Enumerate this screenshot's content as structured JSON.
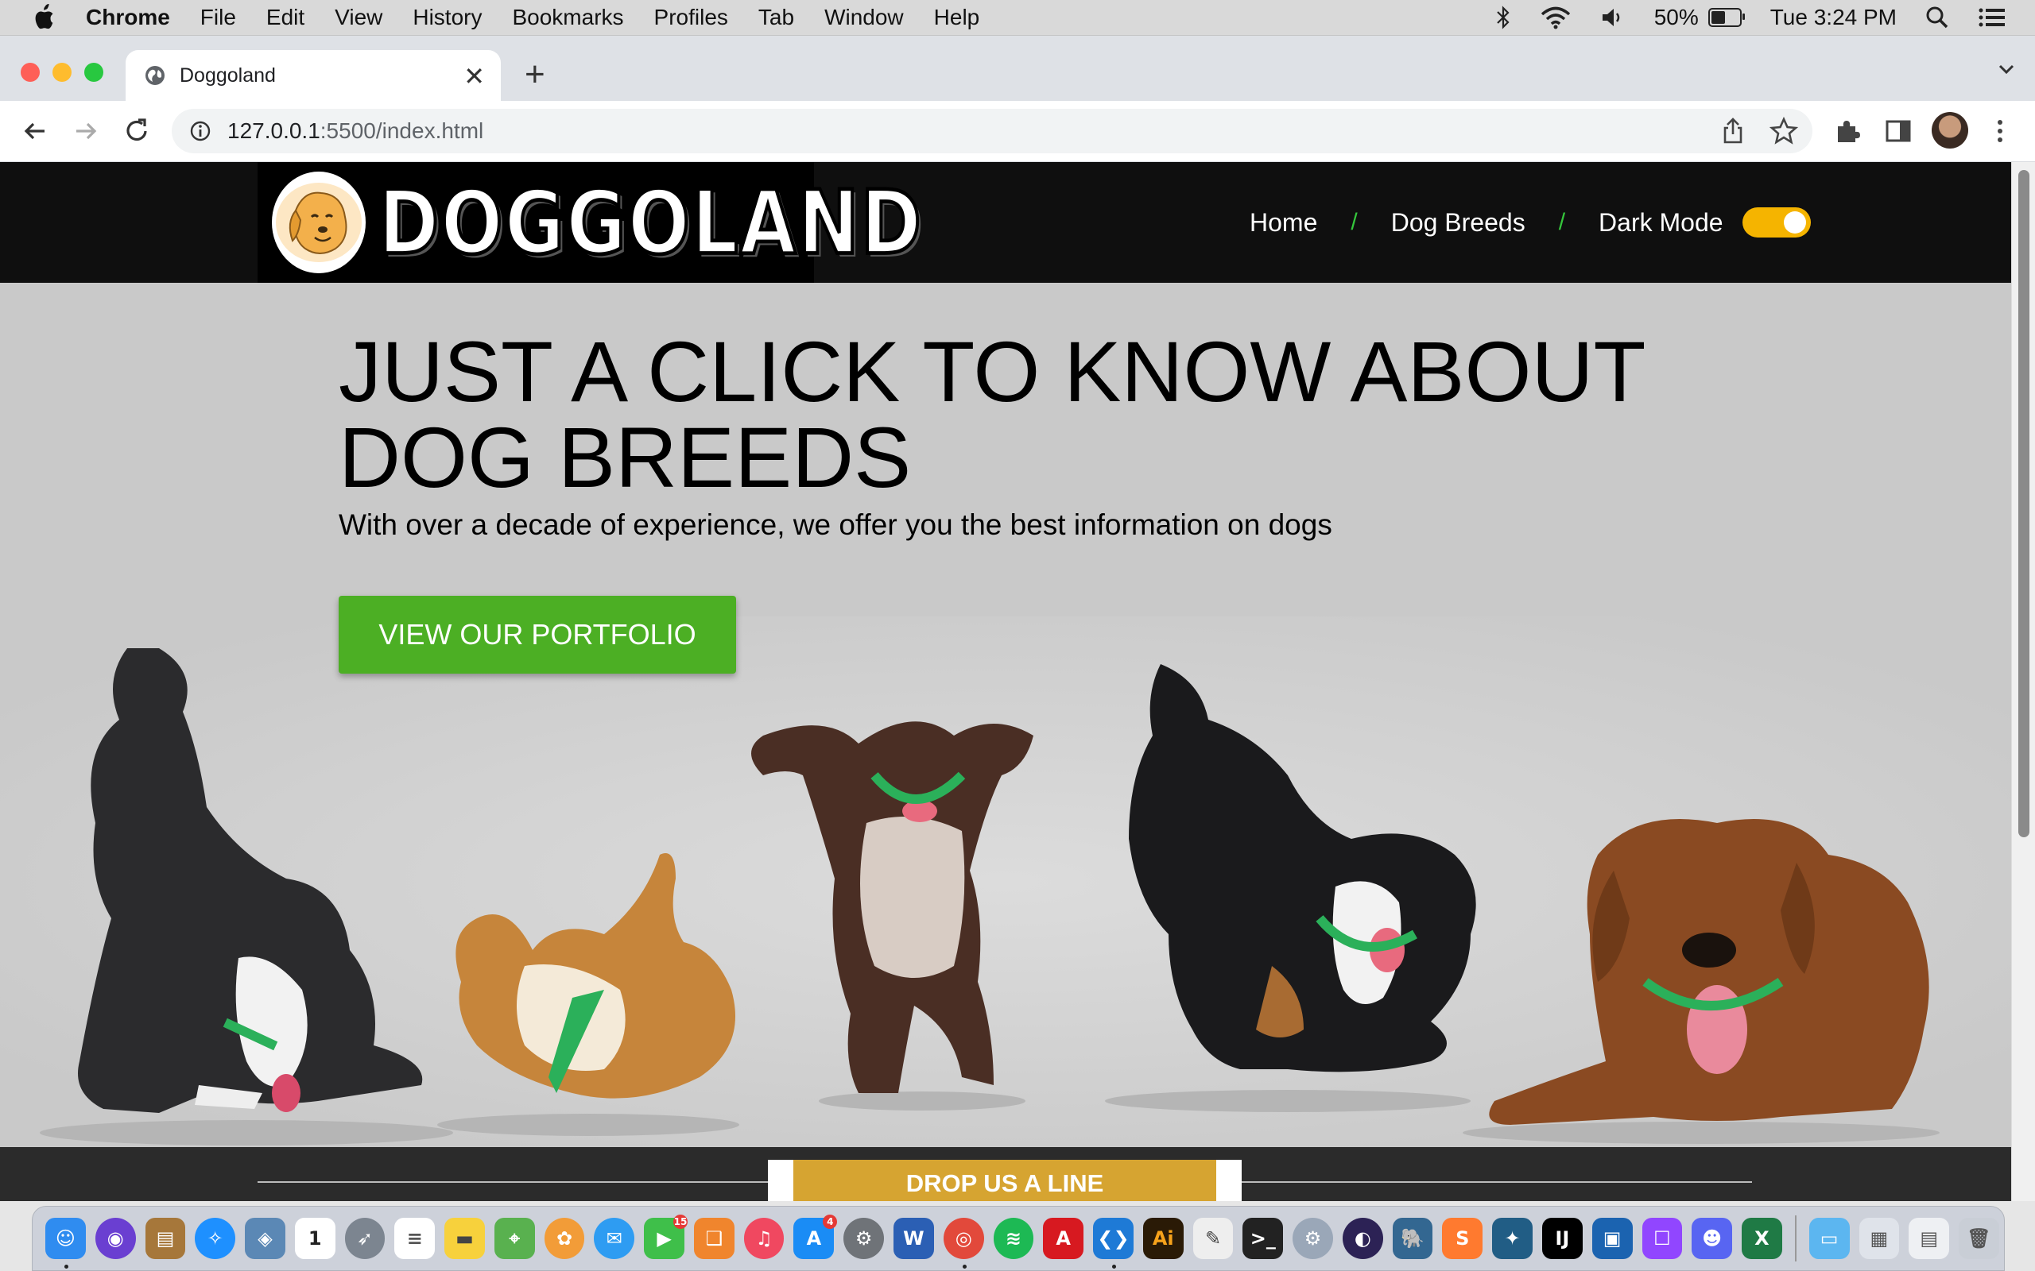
{
  "menubar": {
    "app": "Chrome",
    "items": [
      "File",
      "Edit",
      "View",
      "History",
      "Bookmarks",
      "Profiles",
      "Tab",
      "Window",
      "Help"
    ],
    "battery": "50%",
    "battery_level": 0.5,
    "clock": "Tue 3:24 PM"
  },
  "browser": {
    "tab_title": "Doggoland",
    "url_host": "127.0.0.1",
    "url_rest": ":5500/index.html"
  },
  "site": {
    "nav": {
      "links": [
        "Home",
        "Dog Breeds",
        "Dark Mode"
      ],
      "separator": "/",
      "dark_mode_on": true,
      "toggle_color": "#f5b400",
      "separator_color": "#35c63c"
    },
    "logo_text": "DOGGOLAND",
    "hero": {
      "title": "JUST A CLICK TO KNOW ABOUT DOG BREEDS",
      "subtitle": "With over a decade of experience, we offer you the best information on dogs",
      "cta": "VIEW OUR PORTFOLIO",
      "cta_color": "#4caf24"
    },
    "footer": {
      "drop_button": "DROP US A LINE",
      "drop_color": "#d6a431"
    }
  },
  "dock": {
    "apps": [
      {
        "name": "finder",
        "glyph": "☺",
        "color": "#2f8cf0",
        "dot": true
      },
      {
        "name": "siri",
        "glyph": "◉",
        "color": "#6a3fd1",
        "round": true
      },
      {
        "name": "notefile",
        "glyph": "▤",
        "color": "#a6773a"
      },
      {
        "name": "safari",
        "glyph": "✧",
        "color": "#1e90ff",
        "round": true
      },
      {
        "name": "preview",
        "glyph": "◈",
        "color": "#5b88b5"
      },
      {
        "name": "calendar",
        "glyph": "1",
        "color": "#ffffff",
        "text": "#222"
      },
      {
        "name": "launchpad",
        "glyph": "➶",
        "color": "#7c8590",
        "round": true
      },
      {
        "name": "reminders",
        "glyph": "≡",
        "color": "#ffffff",
        "text": "#555"
      },
      {
        "name": "notes",
        "glyph": "▬",
        "color": "#f7d13c",
        "text": "#444"
      },
      {
        "name": "maps",
        "glyph": "⌖",
        "color": "#59b14f"
      },
      {
        "name": "photos",
        "glyph": "✿",
        "color": "#f29c38",
        "round": true
      },
      {
        "name": "messages",
        "glyph": "✉",
        "color": "#2e9cf2",
        "round": true
      },
      {
        "name": "facetime",
        "glyph": "▶",
        "color": "#3fbf4a",
        "badge": "15"
      },
      {
        "name": "books",
        "glyph": "❑",
        "color": "#f0852d"
      },
      {
        "name": "music",
        "glyph": "♫",
        "color": "#f04860",
        "round": true
      },
      {
        "name": "app-store",
        "glyph": "A",
        "color": "#1a8cf5",
        "badge": "4"
      },
      {
        "name": "system-preferences",
        "glyph": "⚙",
        "color": "#6f7378",
        "round": true
      },
      {
        "name": "word",
        "glyph": "W",
        "color": "#2b5fb4"
      },
      {
        "name": "chrome",
        "glyph": "◎",
        "color": "#e2493b",
        "round": true,
        "dot": true
      },
      {
        "name": "spotify",
        "glyph": "≋",
        "color": "#1db954",
        "round": true
      },
      {
        "name": "acrobat",
        "glyph": "A",
        "color": "#d71920"
      },
      {
        "name": "vscode",
        "glyph": "❮❯",
        "color": "#1e7ad6",
        "dot": true
      },
      {
        "name": "illustrator",
        "glyph": "Ai",
        "color": "#2a1a06",
        "text": "#f7a21b"
      },
      {
        "name": "textedit",
        "glyph": "✎",
        "color": "#eeeeee",
        "text": "#444"
      },
      {
        "name": "terminal",
        "glyph": ">_",
        "color": "#222222"
      },
      {
        "name": "disk-utility",
        "glyph": "⚙",
        "color": "#9aa7b8",
        "round": true
      },
      {
        "name": "eclipse",
        "glyph": "◐",
        "color": "#2c2255",
        "round": true
      },
      {
        "name": "postgres",
        "glyph": "🐘",
        "color": "#336791"
      },
      {
        "name": "sublime",
        "glyph": "S",
        "color": "#ff7a2f"
      },
      {
        "name": "mysql-workbench",
        "glyph": "✦",
        "color": "#215d85"
      },
      {
        "name": "intellij",
        "glyph": "IJ",
        "color": "#000000"
      },
      {
        "name": "virtualbox",
        "glyph": "▣",
        "color": "#1b63b0"
      },
      {
        "name": "twitch",
        "glyph": "☐",
        "color": "#9146ff"
      },
      {
        "name": "discord",
        "glyph": "☻",
        "color": "#5865f2"
      },
      {
        "name": "excel",
        "glyph": "X",
        "color": "#1f7a45"
      }
    ],
    "trailing": [
      {
        "name": "folder",
        "glyph": "▭",
        "color": "#5cb6f0"
      },
      {
        "name": "downloads-stack",
        "glyph": "▦",
        "color": "#dfe3ea",
        "text": "#555"
      },
      {
        "name": "recent-docs",
        "glyph": "▤",
        "color": "#eef0f3",
        "text": "#555"
      },
      {
        "name": "trash",
        "glyph": "🗑",
        "color": "#c9ced6",
        "text": "#555"
      }
    ]
  }
}
